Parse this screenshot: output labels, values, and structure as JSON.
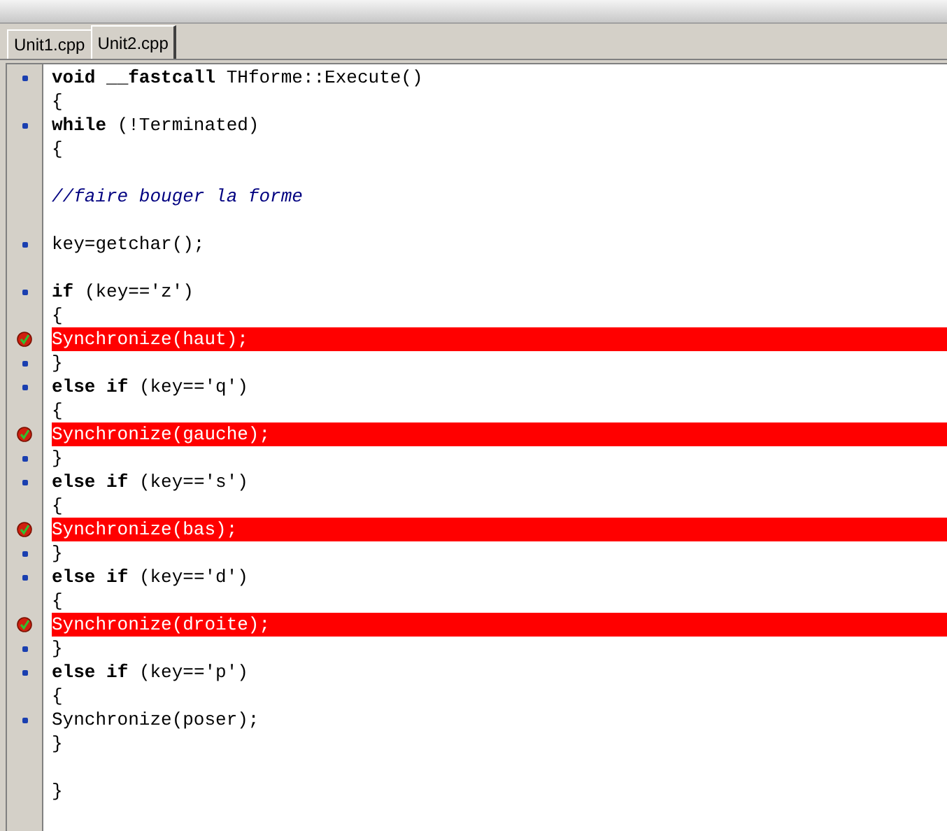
{
  "tabs": [
    {
      "label": "Unit1.cpp",
      "selected": false
    },
    {
      "label": "Unit2.cpp",
      "selected": true
    }
  ],
  "lines": [
    {
      "text": "**void** **__fastcall** THforme::Execute()",
      "kind": "code",
      "executable": true,
      "breakpoint": false,
      "highlighted": false
    },
    {
      "text": "{",
      "kind": "code",
      "executable": false,
      "breakpoint": false,
      "highlighted": false
    },
    {
      "text": "**while** (!Terminated)",
      "kind": "code",
      "executable": true,
      "breakpoint": false,
      "highlighted": false
    },
    {
      "text": "{",
      "kind": "code",
      "executable": false,
      "breakpoint": false,
      "highlighted": false
    },
    {
      "kind": "blank",
      "executable": false,
      "breakpoint": false,
      "highlighted": false
    },
    {
      "text": "//faire bouger la forme",
      "kind": "comment",
      "executable": false,
      "breakpoint": false,
      "highlighted": false
    },
    {
      "kind": "blank",
      "executable": false,
      "breakpoint": false,
      "highlighted": false
    },
    {
      "text": "key=getchar();",
      "kind": "code",
      "executable": true,
      "breakpoint": false,
      "highlighted": false
    },
    {
      "kind": "blank",
      "executable": false,
      "breakpoint": false,
      "highlighted": false
    },
    {
      "text": "**if** (key=='z')",
      "kind": "code",
      "executable": true,
      "breakpoint": false,
      "highlighted": false
    },
    {
      "text": "{",
      "kind": "code",
      "executable": false,
      "breakpoint": false,
      "highlighted": false
    },
    {
      "text": "Synchronize(haut);",
      "kind": "code",
      "executable": true,
      "breakpoint": true,
      "highlighted": true
    },
    {
      "text": "}",
      "kind": "code",
      "executable": true,
      "breakpoint": false,
      "highlighted": false
    },
    {
      "text": "**else** **if** (key=='q')",
      "kind": "code",
      "executable": true,
      "breakpoint": false,
      "highlighted": false
    },
    {
      "text": "{",
      "kind": "code",
      "executable": false,
      "breakpoint": false,
      "highlighted": false
    },
    {
      "text": "Synchronize(gauche);",
      "kind": "code",
      "executable": true,
      "breakpoint": true,
      "highlighted": true
    },
    {
      "text": "}",
      "kind": "code",
      "executable": true,
      "breakpoint": false,
      "highlighted": false
    },
    {
      "text": "**else** **if** (key=='s')",
      "kind": "code",
      "executable": true,
      "breakpoint": false,
      "highlighted": false
    },
    {
      "text": "{",
      "kind": "code",
      "executable": false,
      "breakpoint": false,
      "highlighted": false
    },
    {
      "text": "Synchronize(bas);",
      "kind": "code",
      "executable": true,
      "breakpoint": true,
      "highlighted": true
    },
    {
      "text": "}",
      "kind": "code",
      "executable": true,
      "breakpoint": false,
      "highlighted": false
    },
    {
      "text": "**else** **if** (key=='d')",
      "kind": "code",
      "executable": true,
      "breakpoint": false,
      "highlighted": false
    },
    {
      "text": "{",
      "kind": "code",
      "executable": false,
      "breakpoint": false,
      "highlighted": false
    },
    {
      "text": "Synchronize(droite);",
      "kind": "code",
      "executable": true,
      "breakpoint": true,
      "highlighted": true
    },
    {
      "text": "}",
      "kind": "code",
      "executable": true,
      "breakpoint": false,
      "highlighted": false
    },
    {
      "text": "**else** **if** (key=='p')",
      "kind": "code",
      "executable": true,
      "breakpoint": false,
      "highlighted": false
    },
    {
      "text": "{",
      "kind": "code",
      "executable": false,
      "breakpoint": false,
      "highlighted": false
    },
    {
      "text": "Synchronize(poser);",
      "kind": "code",
      "executable": true,
      "breakpoint": false,
      "highlighted": false
    },
    {
      "text": "}",
      "kind": "code",
      "executable": false,
      "breakpoint": false,
      "highlighted": false
    },
    {
      "kind": "blank",
      "executable": false,
      "breakpoint": false,
      "highlighted": false
    },
    {
      "text": "}",
      "kind": "code",
      "executable": false,
      "breakpoint": false,
      "highlighted": false
    }
  ]
}
